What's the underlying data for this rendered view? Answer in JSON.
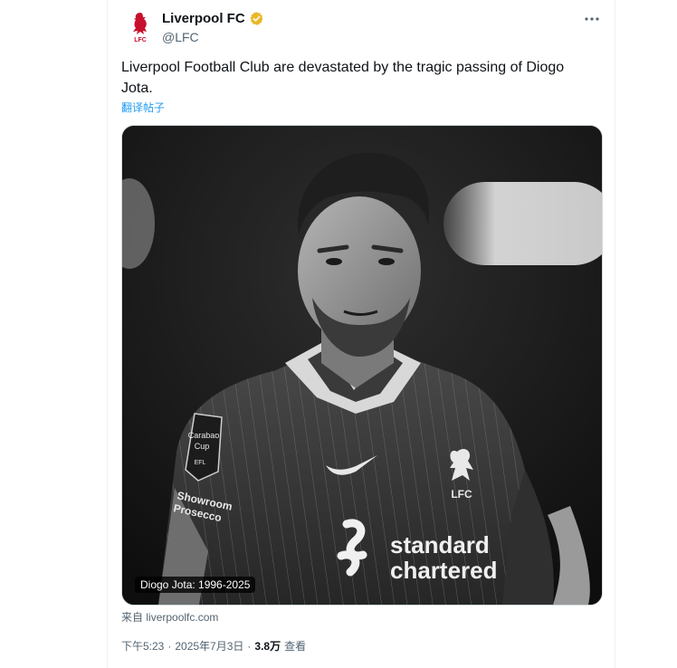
{
  "author": {
    "display_name": "Liverpool FC",
    "handle": "@LFC",
    "verified_badge_color": "#e8b829",
    "avatar_text": "LFC"
  },
  "tweet": {
    "text": "Liverpool Football Club are devastated by the tragic passing of Diogo Jota.",
    "translate_label": "翻译帖子"
  },
  "media": {
    "caption": "Diogo Jota: 1996-2025",
    "crest_text": "LFC",
    "sponsor_line1": "standard",
    "sponsor_line2": "chartered",
    "badge_line1": "Carabao",
    "badge_line2": "Cup",
    "badge_line3": "EFL",
    "sleeve_line1": "Showroom",
    "sleeve_line2": "Prosecco"
  },
  "source": {
    "prefix": "来自",
    "domain": "liverpoolfc.com"
  },
  "meta": {
    "time": "下午5:23",
    "separator": "·",
    "date": "2025年7月3日",
    "views_count": "3.8万",
    "views_label": "查看"
  },
  "colors": {
    "link": "#1d9bf0",
    "secondary_text": "#536471",
    "primary_text": "#0f1419",
    "crest_red": "#c8102e"
  },
  "icons": {
    "more": "three-dots-horizontal",
    "verified": "verified-badge-gold",
    "crest": "liver-bird"
  }
}
